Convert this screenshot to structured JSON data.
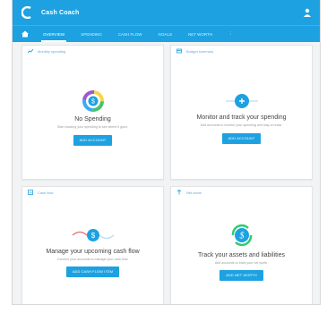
{
  "app": {
    "title": "Cash Coach"
  },
  "tabs": [
    {
      "label": "Overview"
    },
    {
      "label": "Spending"
    },
    {
      "label": "Cash flow"
    },
    {
      "label": "Goals"
    },
    {
      "label": "Net worth"
    },
    {
      "label": "⋮"
    }
  ],
  "cards": {
    "spending": {
      "header": "Monthly spending",
      "title": "No Spending",
      "desc": "Start tracking your spending to see where it goes.",
      "button": "Add account"
    },
    "budget": {
      "header": "Budget summary",
      "title": "Monitor and track your spending",
      "desc": "Add accounts to monitor your spending and stay on track.",
      "button": "Add account"
    },
    "cashflow": {
      "header": "Cash flow",
      "title": "Manage your upcoming cash flow",
      "desc": "Connect your accounts to manage your cash flow.",
      "button": "Add cash flow item"
    },
    "networth": {
      "header": "Net worth",
      "title": "Track your assets and liabilities",
      "desc": "Add accounts to track your net worth.",
      "button": "Add net worth"
    }
  },
  "colors": {
    "primary": "#1da1e1",
    "background": "#f1f3f4"
  }
}
